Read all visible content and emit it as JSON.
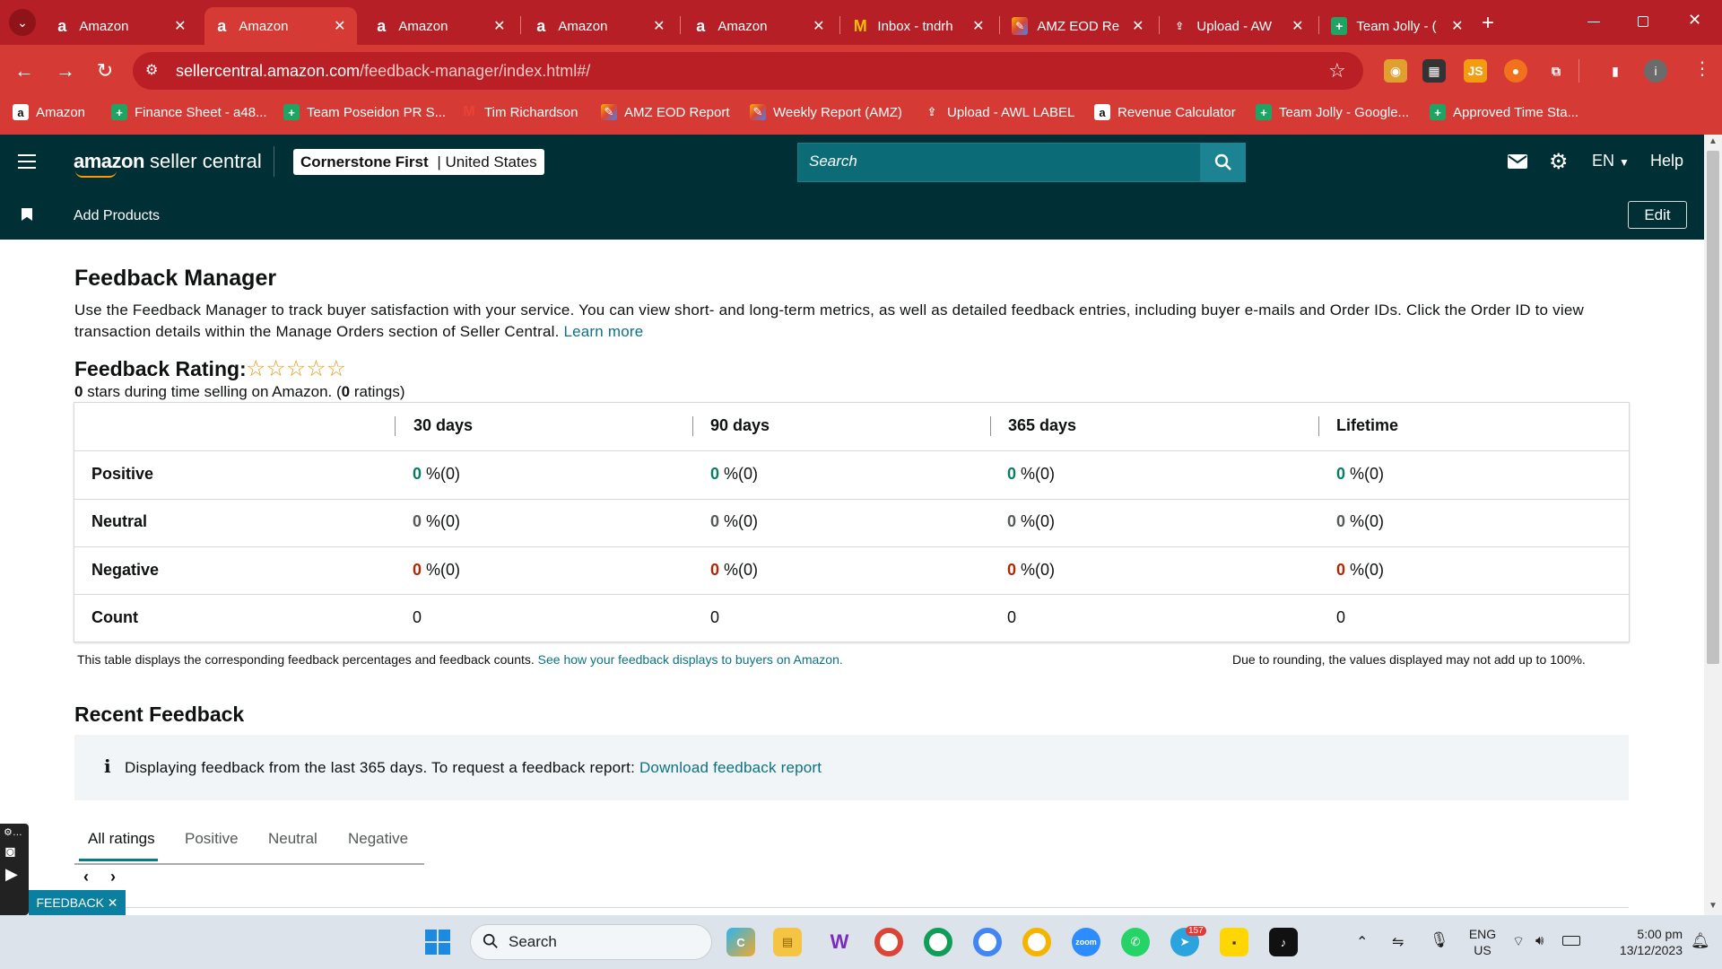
{
  "browser": {
    "tabs": [
      {
        "label": "Amazon",
        "icon": "amazon-icon"
      },
      {
        "label": "Amazon",
        "icon": "amazon-icon",
        "active": true
      },
      {
        "label": "Amazon",
        "icon": "amazon-icon"
      },
      {
        "label": "Amazon",
        "icon": "amazon-icon"
      },
      {
        "label": "Amazon",
        "icon": "amazon-icon"
      },
      {
        "label": "Inbox - tndrh",
        "icon": "gmail-icon"
      },
      {
        "label": "AMZ EOD Re",
        "icon": "markup-icon"
      },
      {
        "label": "Upload - AW",
        "icon": "upload-icon"
      },
      {
        "label": "Team Jolly - (",
        "icon": "sheets-icon"
      }
    ],
    "new_tab": "+",
    "url_host": "sellercentral.amazon.com",
    "url_path": "/feedback-manager/index.html#/",
    "bookmarks": [
      {
        "label": "Amazon",
        "icon": "amazon-icon"
      },
      {
        "label": "Finance Sheet - a48...",
        "icon": "sheets-icon"
      },
      {
        "label": "Team Poseidon PR S...",
        "icon": "sheets-icon"
      },
      {
        "label": "Tim Richardson",
        "icon": "gmail-icon"
      },
      {
        "label": "AMZ EOD Report",
        "icon": "markup-icon"
      },
      {
        "label": "Weekly Report (AMZ)",
        "icon": "markup-icon"
      },
      {
        "label": "Upload - AWL LABEL",
        "icon": "upload-icon"
      },
      {
        "label": "Revenue Calculator",
        "icon": "amazon-icon"
      },
      {
        "label": "Team Jolly - Google...",
        "icon": "sheets-icon"
      },
      {
        "label": "Approved Time Sta...",
        "icon": "sheets-icon"
      }
    ],
    "profile_initial": "i"
  },
  "header": {
    "brand_bold": "amazon",
    "brand_rest": " seller central",
    "store_name": "Cornerstone First",
    "store_sep": " | ",
    "store_region": "United States",
    "search_placeholder": "Search",
    "lang": "EN",
    "help": "Help",
    "sub_link": "Add Products",
    "edit": "Edit"
  },
  "main": {
    "title": "Feedback Manager",
    "intro": "Use the Feedback Manager to track buyer satisfaction with your service. You can view short- and long-term metrics, as well as detailed feedback entries, including buyer e-mails and Order IDs. Click the Order ID to view transaction details within the Manage Orders section of Seller Central.",
    "learn_more": "Learn more",
    "rating_title": "Feedback Rating:",
    "stars": "☆☆☆☆☆",
    "rating_value": "0",
    "rating_mid": " stars during time selling on Amazon. (",
    "rating_count": "0",
    "rating_end": " ratings)",
    "table": {
      "columns": [
        "30 days",
        "90 days",
        "365 days",
        "Lifetime"
      ],
      "rows": [
        {
          "label": "Positive",
          "cells": [
            {
              "num": "0",
              "rest": " %(0)"
            },
            {
              "num": "0",
              "rest": " %(0)"
            },
            {
              "num": "0",
              "rest": " %(0)"
            },
            {
              "num": "0",
              "rest": " %(0)"
            }
          ]
        },
        {
          "label": "Neutral",
          "cells": [
            {
              "num": "0",
              "rest": " %(0)"
            },
            {
              "num": "0",
              "rest": " %(0)"
            },
            {
              "num": "0",
              "rest": " %(0)"
            },
            {
              "num": "0",
              "rest": " %(0)"
            }
          ]
        },
        {
          "label": "Negative",
          "cells": [
            {
              "num": "0",
              "rest": " %(0)"
            },
            {
              "num": "0",
              "rest": " %(0)"
            },
            {
              "num": "0",
              "rest": " %(0)"
            },
            {
              "num": "0",
              "rest": " %(0)"
            }
          ]
        },
        {
          "label": "Count",
          "cells": [
            {
              "num": "",
              "rest": "0"
            },
            {
              "num": "",
              "rest": "0"
            },
            {
              "num": "",
              "rest": "0"
            },
            {
              "num": "",
              "rest": "0"
            }
          ]
        }
      ]
    },
    "footnote_left": "This table displays the corresponding feedback percentages and feedback counts.",
    "footnote_link": "See how your feedback displays to buyers on Amazon.",
    "footnote_right": "Due to rounding, the values displayed may not add up to 100%.",
    "recent_title": "Recent Feedback",
    "info_text": "Displaying feedback from the last 365 days. To request a feedback report:",
    "info_link": "Download feedback report",
    "tabs": [
      "All ratings",
      "Positive",
      "Neutral",
      "Negative"
    ],
    "pager_prev": "‹",
    "pager_next": "›",
    "feedback_tab": "FEEDBACK ✕"
  },
  "taskbar": {
    "search": "Search",
    "lang1": "ENG",
    "lang2": "US",
    "time": "5:00 pm",
    "date": "13/12/2023",
    "telegram_badge": "157"
  },
  "colors": {
    "chrome_red": "#d63a35",
    "header_teal": "#002f36",
    "positive": "#067d62",
    "negative": "#b12704",
    "link": "#0b7285"
  }
}
